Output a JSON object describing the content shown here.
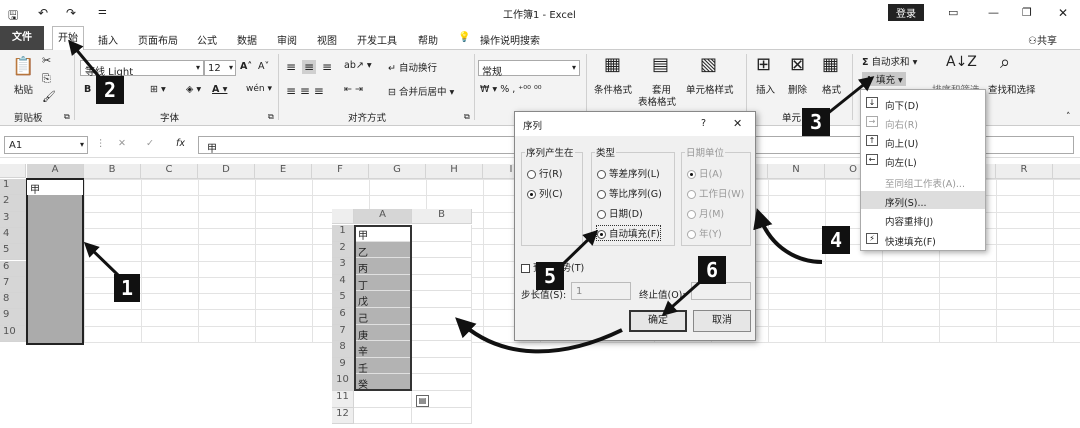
{
  "titlebar": {
    "title": "工作簿1 - Excel",
    "login": "登录"
  },
  "tabs": {
    "file": "文件",
    "home": "开始",
    "insert": "插入",
    "layout": "页面布局",
    "formulas": "公式",
    "data": "数据",
    "review": "审阅",
    "view": "视图",
    "dev": "开发工具",
    "help": "帮助",
    "tell": "操作说明搜索",
    "share": "共享"
  },
  "ribbon": {
    "paste": "粘贴",
    "clipboard": "剪贴板",
    "font_name": "等线 Light",
    "font_size": "12",
    "font_group": "字体",
    "wrap": "自动换行",
    "merge": "合并后居中",
    "align_group": "对齐方式",
    "number_format": "常规",
    "cond_format": "条件格式",
    "table_format_1": "套用",
    "table_format_2": "表格格式",
    "cell_style": "单元格样式",
    "insert": "插入",
    "delete": "删除",
    "format": "格式",
    "cells_group": "单元",
    "autosum": "自动求和",
    "fill": "填充",
    "sort_filter": "排序和筛选",
    "find_select": "查找和选择"
  },
  "formulabar": {
    "name_box": "A1",
    "fx": "fx",
    "content": "甲"
  },
  "sheet": {
    "cols": [
      "A",
      "B",
      "C",
      "D",
      "E",
      "F",
      "G",
      "H",
      "I",
      "",
      "",
      "",
      "",
      "N",
      "O",
      "",
      "",
      "R",
      ""
    ],
    "rows": [
      "1",
      "2",
      "3",
      "4",
      "5",
      "6",
      "7",
      "8",
      "9",
      "10"
    ],
    "a1": "甲"
  },
  "inset": {
    "cols": [
      "A",
      "B"
    ],
    "rows": [
      "1",
      "2",
      "3",
      "4",
      "5",
      "6",
      "7",
      "8",
      "9",
      "10",
      "11",
      "12"
    ],
    "values": [
      "甲",
      "乙",
      "丙",
      "丁",
      "戊",
      "己",
      "庚",
      "辛",
      "壬",
      "癸"
    ]
  },
  "dialog": {
    "title": "序列",
    "help": "?",
    "close": "✕",
    "series_in": "序列产生在",
    "row": "行(R)",
    "col": "列(C)",
    "type": "类型",
    "linear": "等差序列(L)",
    "growth": "等比序列(G)",
    "date": "日期(D)",
    "autofill": "自动填充(F)",
    "date_unit": "日期单位",
    "day": "日(A)",
    "weekday": "工作日(W)",
    "month": "月(M)",
    "year": "年(Y)",
    "trend": "预测趋势(T)",
    "step_label": "步长值(S):",
    "step_value": "1",
    "stop_label": "终止值(O):",
    "ok": "确定",
    "cancel": "取消"
  },
  "fill_menu": {
    "down": "向下(D)",
    "right": "向右(R)",
    "up": "向上(U)",
    "left": "向左(L)",
    "across": "至同组工作表(A)...",
    "series": "序列(S)...",
    "justify": "内容重排(J)",
    "flash": "快速填充(F)"
  },
  "callouts": [
    "1",
    "2",
    "3",
    "4",
    "5",
    "6"
  ]
}
